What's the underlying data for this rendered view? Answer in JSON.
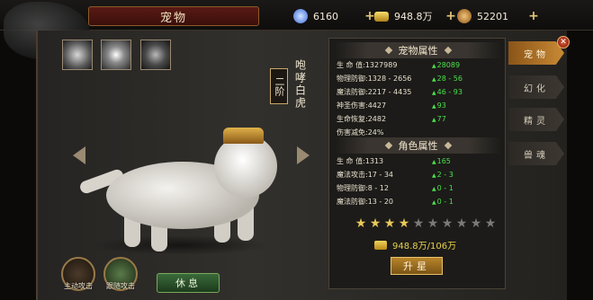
{
  "header": {
    "title": "宠物",
    "resources": [
      {
        "name": "diamond",
        "icon": "diamond-icon",
        "value": "6160",
        "color": "#6aa8ff"
      },
      {
        "name": "gold",
        "icon": "gold-ingot-icon",
        "value": "948.8万",
        "color": "#e8c048"
      },
      {
        "name": "coin",
        "icon": "coin-icon",
        "value": "52201",
        "color": "#d89a3a"
      }
    ],
    "plus": "+"
  },
  "pet": {
    "tier": "二阶",
    "name": "咆哮白虎"
  },
  "bottom": {
    "auto_attack_label": "主动攻击",
    "passive_attack_label": "跟随攻击",
    "rest_label": "休息"
  },
  "pet_attributes": {
    "heading": "宠物属性",
    "rows": [
      {
        "label": "生 命 值:1327989",
        "increase": "28089"
      },
      {
        "label": "物理防御:1328 - 2656",
        "increase": "28 - 56"
      },
      {
        "label": "魔法防御:2217 - 4435",
        "increase": "46 - 93"
      },
      {
        "label": "神圣伤害:4427",
        "increase": "93"
      },
      {
        "label": "生命恢复:2482",
        "increase": "77"
      },
      {
        "label": "伤害减免:24%",
        "increase": ""
      }
    ]
  },
  "role_attributes": {
    "heading": "角色属性",
    "rows": [
      {
        "label": "生 命 值:1313",
        "increase": "165"
      },
      {
        "label": "魔法攻击:17 - 34",
        "increase": "2 - 3"
      },
      {
        "label": "物理防御:8 - 12",
        "increase": "0 - 1"
      },
      {
        "label": "魔法防御:13 - 20",
        "increase": "0 - 1"
      }
    ]
  },
  "stars": {
    "filled": 4,
    "total": 10
  },
  "upgrade": {
    "cost": "948.8万/106万",
    "button_label": "升星"
  },
  "tabs": [
    {
      "label": "宠物",
      "active": true
    },
    {
      "label": "幻化",
      "active": false
    },
    {
      "label": "精灵",
      "active": false
    },
    {
      "label": "兽魂",
      "active": false
    }
  ],
  "colors": {
    "increase": "#4ce04c",
    "star_filled": "#e8c85a",
    "star_empty": "#7a7a7a",
    "accent": "#c88a34"
  }
}
